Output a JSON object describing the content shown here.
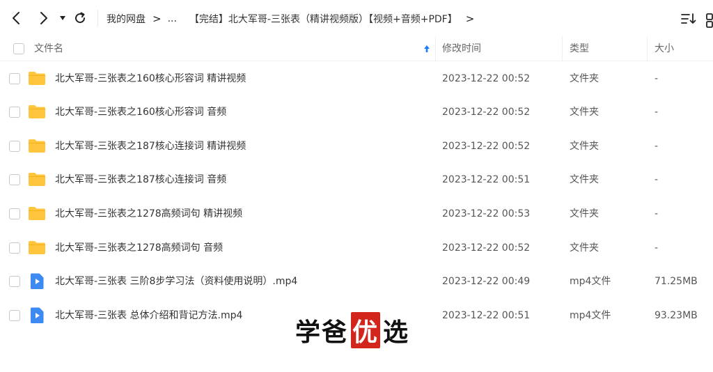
{
  "breadcrumb": {
    "root": "我的网盘",
    "ellipsis": "...",
    "current": "【完结】北大军哥-三张表（精讲视频版）【视频+音频+PDF】",
    "separator": ">"
  },
  "header": {
    "name": "文件名",
    "time": "修改时间",
    "type": "类型",
    "size": "大小"
  },
  "files": [
    {
      "icon": "folder-icon",
      "name": "北大军哥-三张表之160核心形容词 精讲视频",
      "time": "2023-12-22 00:52",
      "type": "文件夹",
      "size": "-"
    },
    {
      "icon": "folder-icon",
      "name": "北大军哥-三张表之160核心形容词 音频",
      "time": "2023-12-22 00:52",
      "type": "文件夹",
      "size": "-"
    },
    {
      "icon": "folder-icon",
      "name": "北大军哥-三张表之187核心连接词 精讲视频",
      "time": "2023-12-22 00:52",
      "type": "文件夹",
      "size": "-"
    },
    {
      "icon": "folder-icon",
      "name": "北大军哥-三张表之187核心连接词 音频",
      "time": "2023-12-22 00:51",
      "type": "文件夹",
      "size": "-"
    },
    {
      "icon": "folder-icon",
      "name": "北大军哥-三张表之1278高频词句 精讲视频",
      "time": "2023-12-22 00:53",
      "type": "文件夹",
      "size": "-"
    },
    {
      "icon": "folder-icon",
      "name": "北大军哥-三张表之1278高频词句 音频",
      "time": "2023-12-22 00:52",
      "type": "文件夹",
      "size": "-"
    },
    {
      "icon": "video-file-icon",
      "name": "北大军哥-三张表 三阶8步学习法（资料使用说明）.mp4",
      "time": "2023-12-22 00:49",
      "type": "mp4文件",
      "size": "71.25MB"
    },
    {
      "icon": "video-file-icon",
      "name": "北大军哥-三张表 总体介绍和背记方法.mp4",
      "time": "2023-12-22 00:51",
      "type": "mp4文件",
      "size": "93.23MB"
    }
  ],
  "watermark": {
    "part1": "学爸",
    "highlight": "优",
    "part2": "选"
  },
  "colors": {
    "folder": "#FFC53D",
    "video": "#3D8BF2",
    "sort_arrow": "#1E7BEF",
    "watermark_highlight": "#D2261C"
  }
}
